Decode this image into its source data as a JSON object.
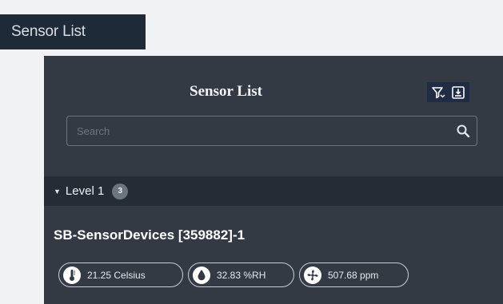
{
  "page_tab": {
    "label": "Sensor List"
  },
  "panel": {
    "title": "Sensor List",
    "search": {
      "placeholder": "Search",
      "value": ""
    },
    "group": {
      "label": "Level 1",
      "count": "3"
    },
    "device": {
      "name": "SB-SensorDevices [359882]-1",
      "readings": [
        {
          "icon": "thermometer-icon",
          "text": "21.25 Celsius"
        },
        {
          "icon": "water-drop-icon",
          "text": "32.83 %RH"
        },
        {
          "icon": "fan-icon",
          "text": "507.68 ppm"
        }
      ]
    }
  },
  "colors": {
    "panel_bg": "#333a44",
    "tab_bg": "#1f2a39",
    "group_row_bg": "#262c35",
    "toolbar_bg": "#1f2c44"
  }
}
